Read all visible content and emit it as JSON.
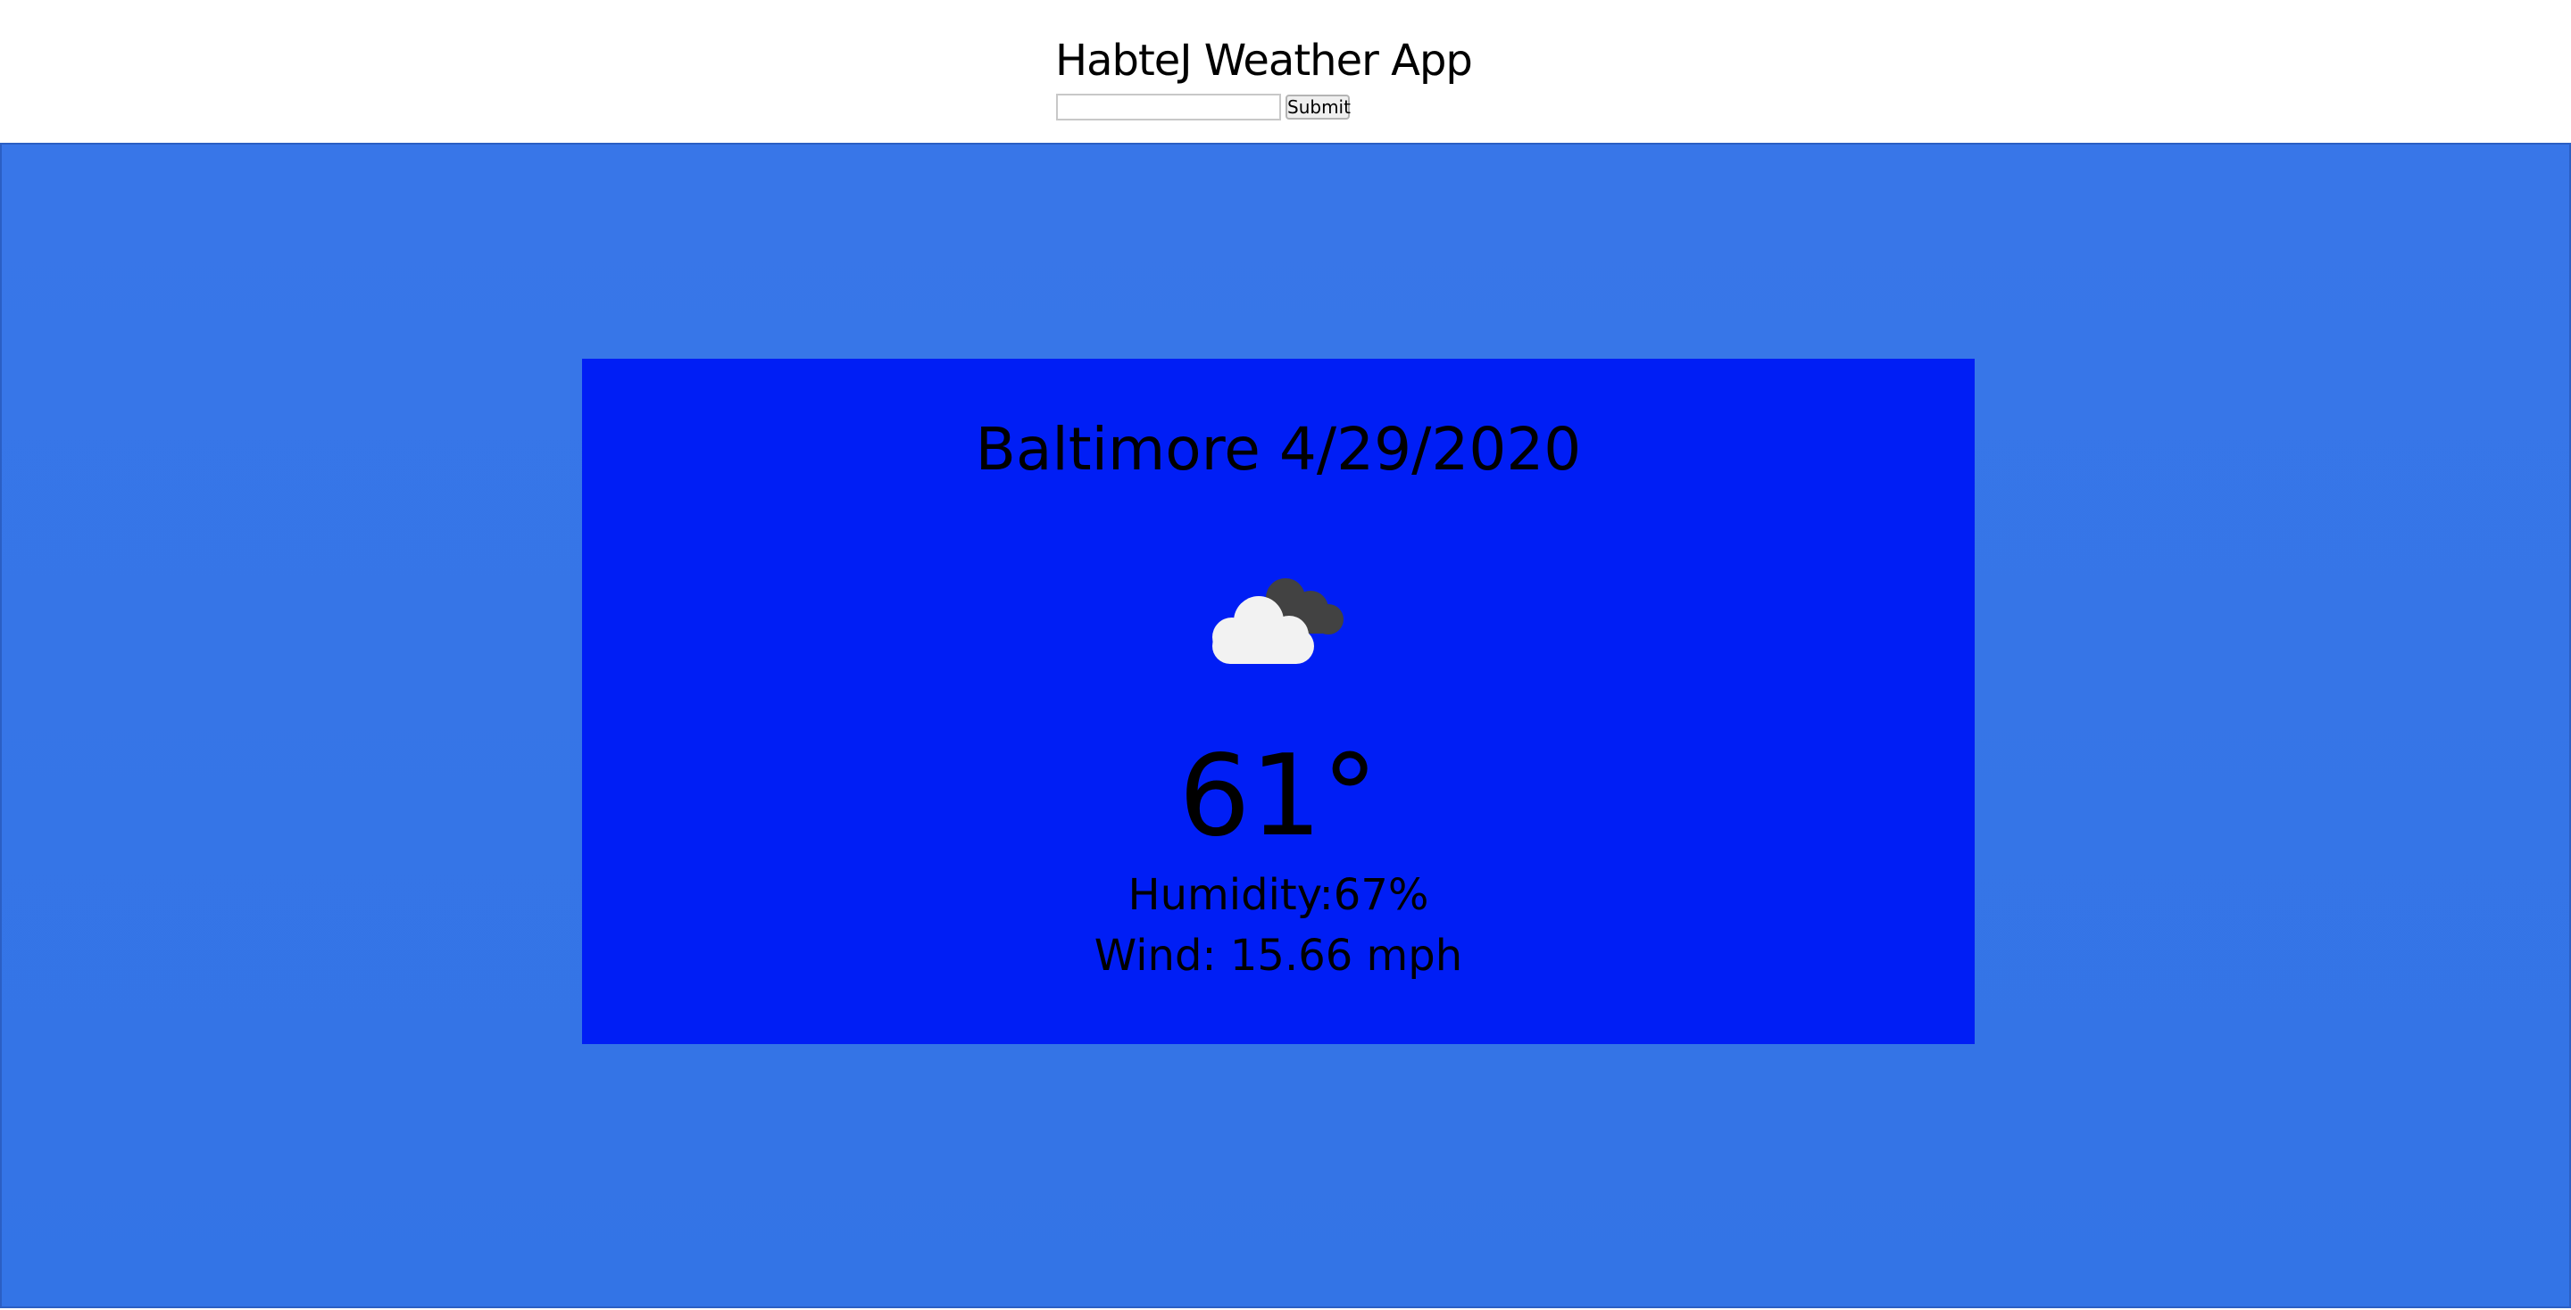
{
  "header": {
    "title": "HabteJ Weather App",
    "search": {
      "value": "",
      "placeholder": ""
    },
    "submit_label": "Submit"
  },
  "weather": {
    "city_date": "Baltimore 4/29/2020",
    "icon": "cloudy-icon",
    "temperature": "61°",
    "humidity": "Humidity:67%",
    "wind": "Wind: 15.66 mph"
  },
  "colors": {
    "header_bg": "#ffffff",
    "page_bg": "#3876e8",
    "card_bg": "#001ef5",
    "cloud_front": "#f2f2f2",
    "cloud_back": "#424242"
  }
}
